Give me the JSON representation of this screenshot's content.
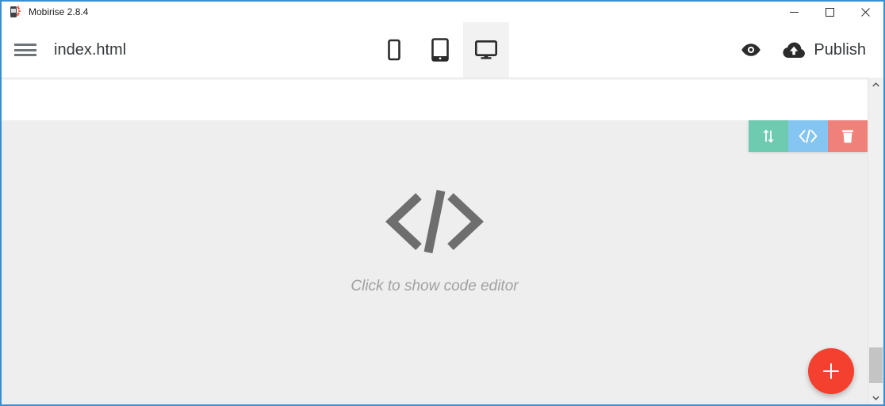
{
  "window": {
    "app_title": "Mobirise 2.8.4",
    "app_icon": "mobirise-logo-icon",
    "controls": {
      "minimize": "minimize-icon",
      "maximize": "maximize-icon",
      "close": "close-icon"
    },
    "accent_border": "#3a8fd4"
  },
  "header": {
    "menu_icon": "hamburger-menu-icon",
    "document_title": "index.html",
    "device_tabs": [
      {
        "icon": "mobile-phone-icon",
        "name": "mobile",
        "active": false
      },
      {
        "icon": "tablet-icon",
        "name": "tablet",
        "active": false
      },
      {
        "icon": "desktop-icon",
        "name": "desktop",
        "active": true
      }
    ],
    "preview_icon": "eye-preview-icon",
    "publish": {
      "icon": "cloud-upload-icon",
      "label": "Publish"
    }
  },
  "canvas": {
    "block_toolbar": [
      {
        "name": "move-block",
        "icon": "arrows-up-down-icon",
        "color": "#6ecbb0"
      },
      {
        "name": "edit-code",
        "icon": "code-brackets-icon",
        "color": "#84c5f2"
      },
      {
        "name": "delete-block",
        "icon": "trash-can-icon",
        "color": "#f0817a"
      }
    ],
    "code_block": {
      "glyph": "</>",
      "caption": "Click to show code editor"
    },
    "add_block_button": {
      "name": "add-block",
      "icon": "plus-icon",
      "color": "#f4402e"
    },
    "scrollbar": {
      "up_icon": "chevron-up-icon",
      "down_icon": "chevron-down-icon"
    }
  }
}
